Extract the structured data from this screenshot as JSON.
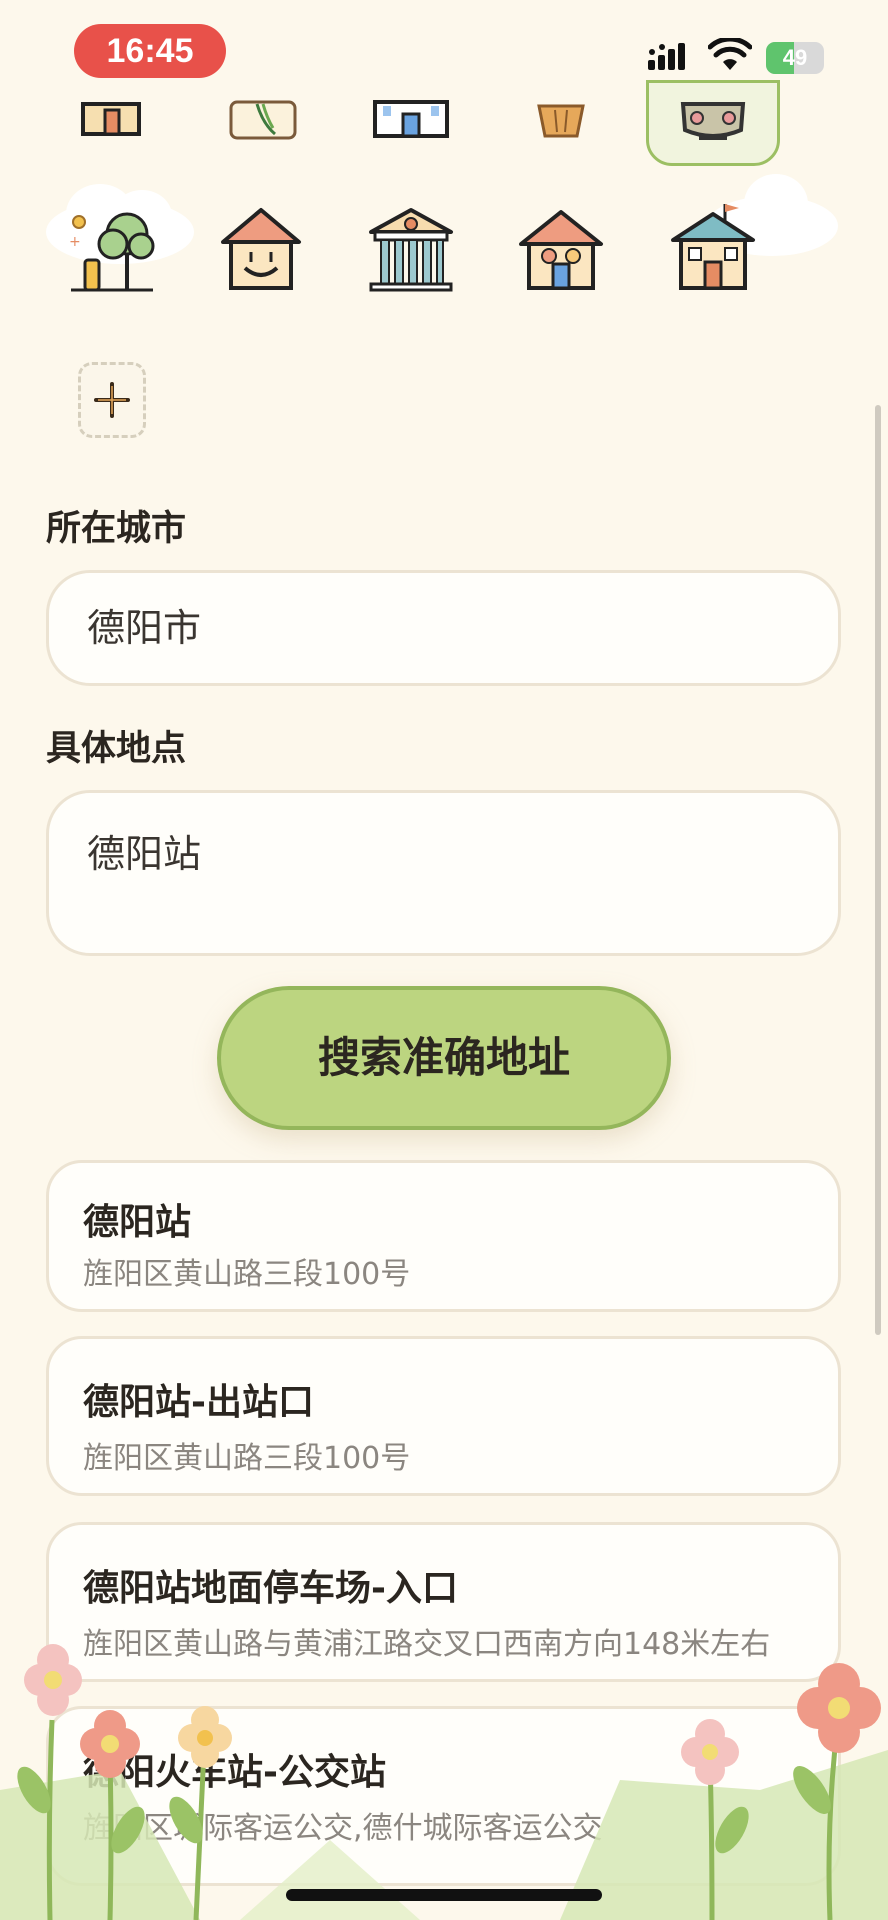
{
  "status_bar": {
    "time": "16:45",
    "battery_text": "49",
    "battery_level": 0.49,
    "icons": [
      "cellular-signal-icon",
      "wifi-icon",
      "battery-charging-icon"
    ]
  },
  "icon_picker": {
    "row1": [
      "door-house-icon",
      "plant-box-icon",
      "blue-building-icon",
      "basket-icon",
      "creature-icon"
    ],
    "row2": [
      "park-trees-icon",
      "smile-house-icon",
      "bank-icon",
      "family-house-icon",
      "flag-house-icon"
    ],
    "selected": "creature-icon",
    "add_icon": "plus-icon"
  },
  "form": {
    "city_label": "所在城市",
    "city_value": "德阳市",
    "place_label": "具体地点",
    "place_value": "德阳站",
    "search_button": "搜索准确地址"
  },
  "results": [
    {
      "name": "德阳站",
      "address": "旌阳区黄山路三段100号"
    },
    {
      "name": "德阳站-出站口",
      "address": "旌阳区黄山路三段100号"
    },
    {
      "name": "德阳站地面停车场-入口",
      "address": "旌阳区黄山路与黄浦江路交叉口西南方向148米左右"
    },
    {
      "name": "德阳火车站-公交站",
      "address": "旌阳区城际客运公交,德什城际客运公交"
    }
  ],
  "colors": {
    "background": "#fdf8ec",
    "accent_green": "#bcd580",
    "time_pill": "#e8514a",
    "card_border": "#ece3d2"
  }
}
